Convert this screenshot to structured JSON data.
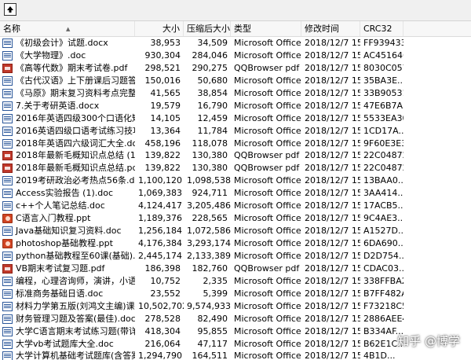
{
  "columns": {
    "name": "名称",
    "size": "大小",
    "packed": "压缩后大小",
    "type": "类型",
    "modified": "修改时间",
    "crc": "CRC32"
  },
  "files": [
    {
      "name": "《初级会计》试题.docx",
      "size": "38,953",
      "packed": "34,509",
      "type": "Microsoft Office ...",
      "modified": "2018/12/7 15...",
      "crc": "FF939433",
      "icon": "doc"
    },
    {
      "name": "《大学物理》.doc",
      "size": "930,304",
      "packed": "284,046",
      "type": "Microsoft Office ...",
      "modified": "2018/12/7 15...",
      "crc": "AC451646",
      "icon": "doc"
    },
    {
      "name": "《高等代数》期末考试卷.pdf",
      "size": "298,521",
      "packed": "290,275",
      "type": "QQBrowser pdf ...",
      "modified": "2018/12/7 15...",
      "crc": "8030C057",
      "icon": "pdf"
    },
    {
      "name": "《古代汉语》上下册课后习题答案(...",
      "size": "150,016",
      "packed": "50,680",
      "type": "Microsoft Office ...",
      "modified": "2018/12/7 15...",
      "crc": "35BA3E...",
      "icon": "doc"
    },
    {
      "name": "《马原》期末复习资料考点完整.docx",
      "size": "41,565",
      "packed": "38,854",
      "type": "Microsoft Office ...",
      "modified": "2018/12/7 15...",
      "crc": "33B90531",
      "icon": "doc"
    },
    {
      "name": "7.关于考研英语.docx",
      "size": "19,579",
      "packed": "16,790",
      "type": "Microsoft Office ...",
      "modified": "2018/12/7 15...",
      "crc": "47E6B7A5",
      "icon": "doc"
    },
    {
      "name": "2016年英语四级300个口语化短语...",
      "size": "14,105",
      "packed": "12,459",
      "type": "Microsoft Office ...",
      "modified": "2018/12/7 15...",
      "crc": "5533EA30",
      "icon": "doc"
    },
    {
      "name": "2016英语四级口语考试练习技巧.d...",
      "size": "13,364",
      "packed": "11,784",
      "type": "Microsoft Office ...",
      "modified": "2018/12/7 15...",
      "crc": "1CD17A...",
      "icon": "doc"
    },
    {
      "name": "2018年英语四六级词汇大全.doc",
      "size": "458,196",
      "packed": "118,078",
      "type": "Microsoft Office ...",
      "modified": "2018/12/7 15...",
      "crc": "9F60E3E3",
      "icon": "doc"
    },
    {
      "name": "2018年最新毛概知识点总结 (1).pdf",
      "size": "139,822",
      "packed": "130,380",
      "type": "QQBrowser pdf ...",
      "modified": "2018/12/7 15...",
      "crc": "22C04872",
      "icon": "pdf"
    },
    {
      "name": "2018年最新毛概知识点总结.pdf",
      "size": "139,822",
      "packed": "130,380",
      "type": "QQBrowser pdf ...",
      "modified": "2018/12/7 15...",
      "crc": "22C04872",
      "icon": "pdf"
    },
    {
      "name": "2019考研政治必考热点56条.docx",
      "size": "1,100,120",
      "packed": "1,098,538",
      "type": "Microsoft Office ...",
      "modified": "2018/12/7 15...",
      "crc": "13BAA0...",
      "icon": "doc"
    },
    {
      "name": "Access实验报告 (1).doc",
      "size": "1,069,383",
      "packed": "924,711",
      "type": "Microsoft Office ...",
      "modified": "2018/12/7 15...",
      "crc": "3AA414...",
      "icon": "doc"
    },
    {
      "name": "c++个人笔记总结.doc",
      "size": "4,124,417",
      "packed": "3,205,486",
      "type": "Microsoft Office ...",
      "modified": "2018/12/7 15...",
      "crc": "17ACB5...",
      "icon": "doc"
    },
    {
      "name": "C语言入门教程.ppt",
      "size": "1,189,376",
      "packed": "228,565",
      "type": "Microsoft Office ...",
      "modified": "2018/12/7 15...",
      "crc": "9C4AE3...",
      "icon": "ppt"
    },
    {
      "name": "Java基础知识复习资料.doc",
      "size": "1,256,184",
      "packed": "1,072,586",
      "type": "Microsoft Office ...",
      "modified": "2018/12/7 15...",
      "crc": "A1527D...",
      "icon": "doc"
    },
    {
      "name": "photoshop基础教程.ppt",
      "size": "4,176,384",
      "packed": "3,293,174",
      "type": "Microsoft Office ...",
      "modified": "2018/12/7 15...",
      "crc": "6DA690...",
      "icon": "ppt"
    },
    {
      "name": "python基础教程至60课(基础).docx",
      "size": "2,445,174",
      "packed": "2,133,389",
      "type": "Microsoft Office ...",
      "modified": "2018/12/7 15...",
      "crc": "D2D754...",
      "icon": "doc"
    },
    {
      "name": "VB期末考试复习题.pdf",
      "size": "186,398",
      "packed": "182,760",
      "type": "QQBrowser pdf ...",
      "modified": "2018/12/7 15...",
      "crc": "CDAC03...",
      "icon": "pdf"
    },
    {
      "name": "编程，心理咨询师，演讲，小语种...",
      "size": "10,752",
      "size_note": "",
      "packed": "2,335",
      "type": "Microsoft Office ...",
      "modified": "2018/12/7 15...",
      "crc": "338FFBA2",
      "icon": "doc"
    },
    {
      "name": "标准商务基础日语.doc",
      "size": "23,552",
      "packed": "5,399",
      "type": "Microsoft Office ...",
      "modified": "2018/12/7 15...",
      "crc": "B7FF482A",
      "icon": "doc"
    },
    {
      "name": "材料力学第五版(刘鸿文主编)课后答...",
      "size": "10,502,702",
      "packed": "9,574,933",
      "type": "Microsoft Office ...",
      "modified": "2018/12/7 15...",
      "crc": "F73218C5",
      "icon": "doc"
    },
    {
      "name": "财务管理习题及答案(最佳).doc",
      "size": "278,528",
      "packed": "82,490",
      "type": "Microsoft Office ...",
      "modified": "2018/12/7 15...",
      "crc": "2886AEE4",
      "icon": "doc"
    },
    {
      "name": "大学C语言期末考试练习题(带详解...",
      "size": "418,304",
      "packed": "95,855",
      "type": "Microsoft Office ...",
      "modified": "2018/12/7 15...",
      "crc": "B334AF...",
      "icon": "doc"
    },
    {
      "name": "大学vb考试题库大全.doc",
      "size": "216,064",
      "packed": "47,117",
      "type": "Microsoft Office ...",
      "modified": "2018/12/7 15...",
      "crc": "B62E1C...",
      "icon": "doc"
    },
    {
      "name": "大学计算机基础考试题库(含答案)...",
      "size": "1,294,790",
      "packed": "164,511",
      "type": "Microsoft Office ...",
      "modified": "2018/12/7 15...",
      "crc": "4B1D...",
      "icon": "doc"
    }
  ],
  "watermark": "知乎 @博学"
}
